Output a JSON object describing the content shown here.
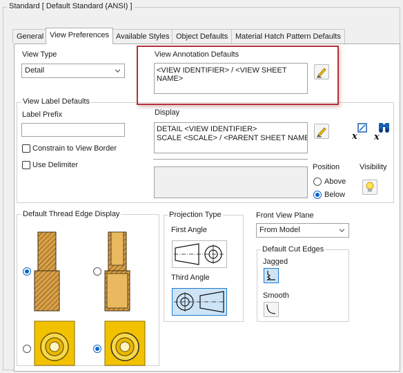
{
  "dialog": {
    "title": "Standard [ Default Standard (ANSI) ]"
  },
  "tabs": [
    "General",
    "View Preferences",
    "Available Styles",
    "Object Defaults",
    "Material Hatch Pattern Defaults"
  ],
  "view_type": {
    "label": "View Type",
    "selected": "Detail"
  },
  "annotation_defaults": {
    "label": "View Annotation Defaults",
    "text": "<VIEW IDENTIFIER> / <VIEW SHEET NAME>"
  },
  "view_label_defaults": {
    "title": "View Label Defaults",
    "prefix_label": "Label Prefix",
    "prefix_value": "",
    "constrain_label": "Constrain to View Border",
    "constrain_checked": false,
    "delimiter_label": "Use Delimiter",
    "delimiter_checked": false,
    "display_label": "Display",
    "display_line1": "DETAIL  <VIEW IDENTIFIER>",
    "display_line2": "SCALE <SCALE> / <PARENT SHEET NAME><",
    "position_label": "Position",
    "above_label": "Above",
    "below_label": "Below",
    "position_selected": "Below",
    "visibility_label": "Visibility"
  },
  "thread_edge": {
    "title": "Default Thread Edge Display",
    "selected": "left"
  },
  "projection": {
    "title": "Projection Type",
    "first_angle": "First Angle",
    "third_angle": "Third Angle",
    "selected": "Third Angle"
  },
  "front_view_plane": {
    "label": "Front View Plane",
    "selected": "From Model"
  },
  "cut_edges": {
    "title": "Default Cut Edges",
    "jagged": "Jagged",
    "smooth": "Smooth",
    "selected": "Jagged"
  },
  "icons": {
    "edit": "pencil-edit-icon",
    "text_params": "text-parameter-icon",
    "binoculars": "binoculars-parameter-icon",
    "visibility": "lightbulb-icon"
  }
}
